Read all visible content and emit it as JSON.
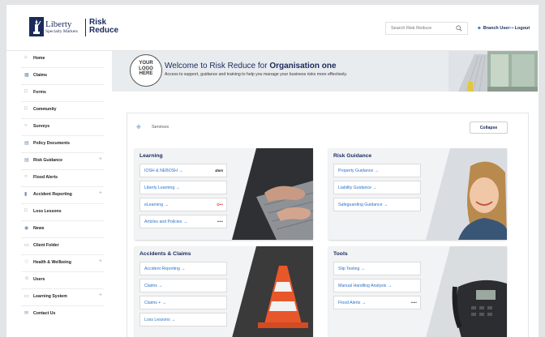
{
  "header": {
    "logo_name": "Liberty",
    "logo_sub": "Specialty Markets",
    "brand": "Risk Reduce",
    "search_placeholder": "Search Risk Reduce",
    "user_label": "Branch User",
    "logout_label": "Logout"
  },
  "sidebar": {
    "items": [
      {
        "label": "Home",
        "icon": "home-icon",
        "expandable": false
      },
      {
        "label": "Claims",
        "icon": "claims-icon",
        "expandable": false
      },
      {
        "label": "Forms",
        "icon": "forms-icon",
        "expandable": false
      },
      {
        "label": "Community",
        "icon": "community-icon",
        "expandable": false
      },
      {
        "label": "Surveys",
        "icon": "surveys-icon",
        "expandable": false
      },
      {
        "label": "Policy Documents",
        "icon": "document-icon",
        "expandable": false
      },
      {
        "label": "Risk Guidance",
        "icon": "guidance-icon",
        "expandable": true
      },
      {
        "label": "Flood Alerts",
        "icon": "flood-icon",
        "expandable": false
      },
      {
        "label": "Accident Reporting",
        "icon": "chart-icon",
        "expandable": true
      },
      {
        "label": "Loss Lessons",
        "icon": "lessons-icon",
        "expandable": false
      },
      {
        "label": "News",
        "icon": "news-icon",
        "expandable": false
      },
      {
        "label": "Client Folder",
        "icon": "folder-icon",
        "expandable": false
      },
      {
        "label": "Health & Wellbeing",
        "icon": "health-icon",
        "expandable": true
      },
      {
        "label": "Users",
        "icon": "users-icon",
        "expandable": false
      },
      {
        "label": "Learning System",
        "icon": "learning-icon",
        "expandable": true
      },
      {
        "label": "Contact Us",
        "icon": "contact-icon",
        "expandable": false
      }
    ]
  },
  "banner": {
    "logo_lines": [
      "YOUR",
      "LOGO",
      "HERE"
    ],
    "title_prefix": "Welcome to Risk Reduce for ",
    "title_org": "Organisation one",
    "subtitle": "Access to support, guidance and training to help you manage your business risks more effectively."
  },
  "services": {
    "label": "Services",
    "collapse_label": "Collapse",
    "cards": [
      {
        "title": "Learning",
        "links": [
          {
            "label": "IOSH & NEBOSH →",
            "badge": "4mm"
          },
          {
            "label": "Liberty Learning →",
            "badge": ""
          },
          {
            "label": "eLearning →",
            "badge": "O•••"
          },
          {
            "label": "Articles and Policies →",
            "badge": "•••••"
          }
        ]
      },
      {
        "title": "Risk Guidance",
        "links": [
          {
            "label": "Property Guidance →",
            "badge": ""
          },
          {
            "label": "Liability Guidance →",
            "badge": ""
          },
          {
            "label": "Safeguarding Guidance →",
            "badge": ""
          }
        ]
      },
      {
        "title": "Accidents & Claims",
        "links": [
          {
            "label": "Accident Reporting →",
            "badge": ""
          },
          {
            "label": "Claims →",
            "badge": ""
          },
          {
            "label": "Claims + →",
            "badge": ""
          },
          {
            "label": "Loss Lessons →",
            "badge": ""
          }
        ]
      },
      {
        "title": "Tools",
        "links": [
          {
            "label": "Slip Testing →",
            "badge": ""
          },
          {
            "label": "Manual Handling Analysis →",
            "badge": ""
          },
          {
            "label": "Flood Alerts →",
            "badge": "•••••"
          }
        ]
      }
    ]
  },
  "colors": {
    "navy": "#1a2a5a",
    "link_blue": "#2a72c9",
    "elearning_red": "#d9332b"
  }
}
